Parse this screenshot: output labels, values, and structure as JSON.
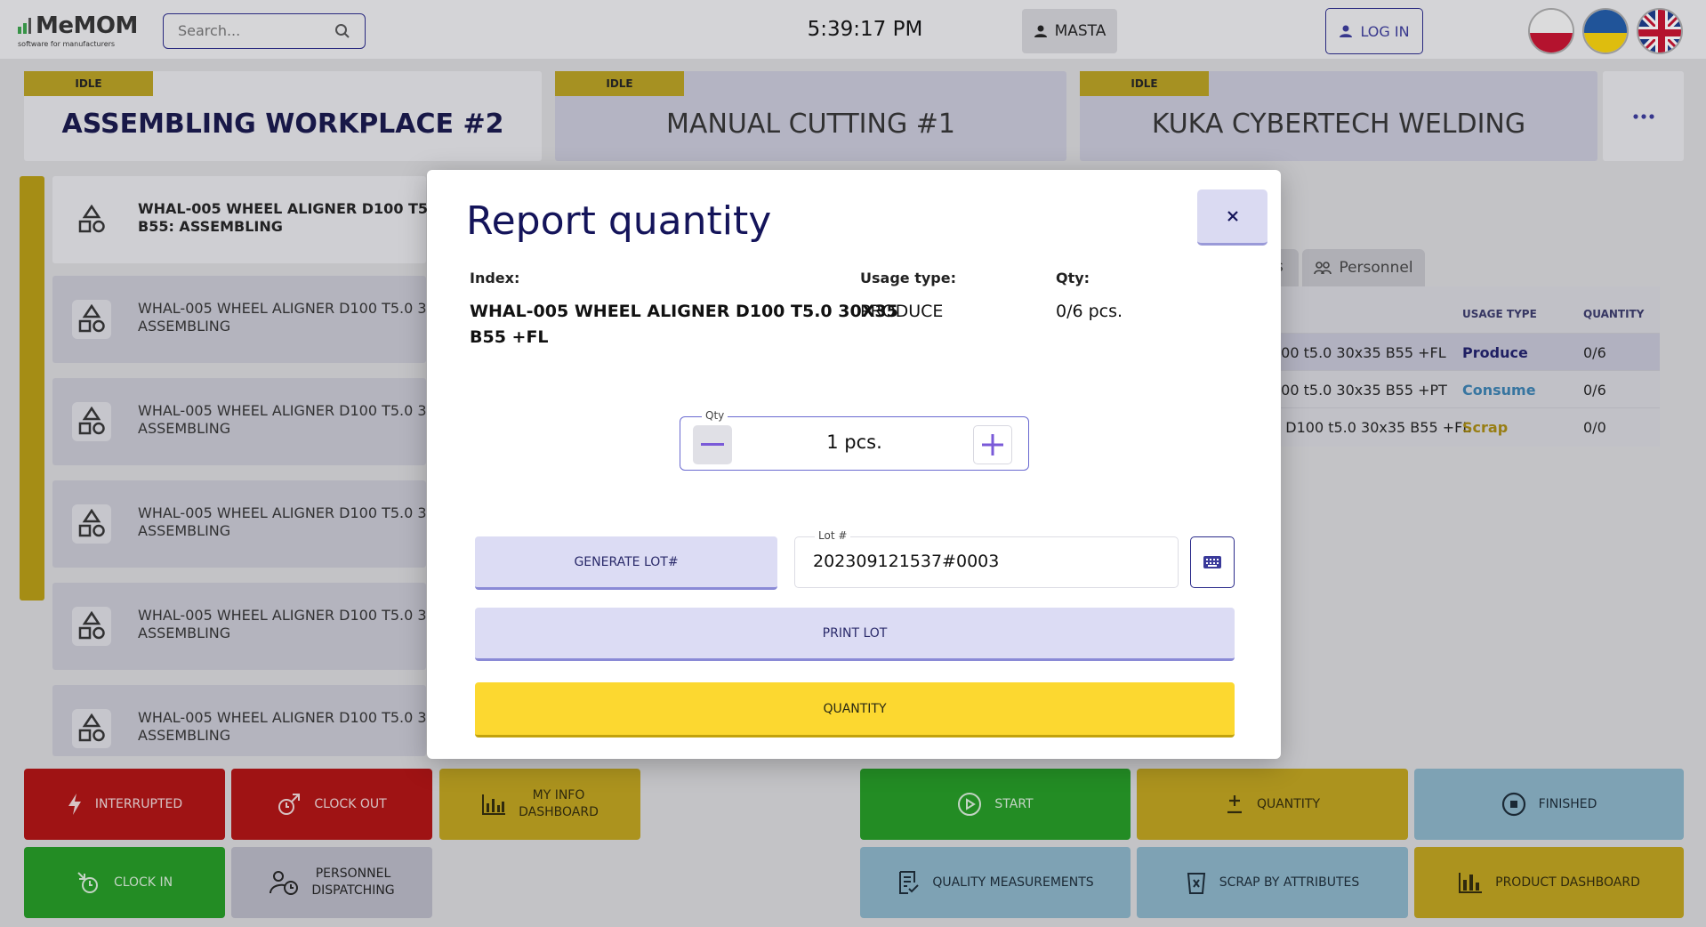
{
  "app": {
    "logo_name": "MeMOM",
    "logo_tagline": "software for manufacturers",
    "time": "5:39:17 PM",
    "user_label": "MASTA",
    "login_label": "LOG IN"
  },
  "search": {
    "placeholder": "Search..."
  },
  "languages": [
    "pl",
    "ua",
    "en"
  ],
  "workplaces": [
    {
      "status": "IDLE",
      "name": "ASSEMBLING WORKPLACE #2",
      "active": true
    },
    {
      "status": "IDLE",
      "name": "MANUAL CUTTING #1",
      "active": false
    },
    {
      "status": "IDLE",
      "name": "KUKA CYBERTECH WELDING",
      "active": false
    }
  ],
  "tasks": [
    {
      "line1": "WHAL-005 WHEEL ALIGNER D100 T5.0 30X35",
      "line2": "B55: ASSEMBLING"
    },
    {
      "line1": "WHAL-005 WHEEL ALIGNER D100 T5.0 30X35",
      "line2": "ASSEMBLING"
    },
    {
      "line1": "WHAL-005 WHEEL ALIGNER D100 T5.0 30X35",
      "line2": "ASSEMBLING"
    },
    {
      "line1": "WHAL-005 WHEEL ALIGNER D100 T5.0 30X35",
      "line2": "ASSEMBLING"
    },
    {
      "line1": "WHAL-005 WHEEL ALIGNER D100 T5.0 30X35",
      "line2": "ASSEMBLING"
    },
    {
      "line1": "WHAL-005 WHEEL ALIGNER D100 T5.0 30X35",
      "line2": "ASSEMBLING"
    }
  ],
  "detail_tabs": {
    "partial": "s",
    "personnel": "Personnel"
  },
  "materials_table": {
    "headers": {
      "usage_type": "USAGE TYPE",
      "quantity": "QUANTITY"
    },
    "rows": [
      {
        "name": "100 t5.0 30x35 B55 +FL",
        "usage": "Produce",
        "qty": "0/6",
        "color": "#1e1e6a"
      },
      {
        "name": "100 t5.0 30x35 B55 +PT",
        "usage": "Consume",
        "qty": "0/6",
        "color": "#3a80b0"
      },
      {
        "name": "2 D100 t5.0 30x35 B55 +FL",
        "usage": "Scrap",
        "qty": "0/0",
        "color": "#a88a10"
      }
    ]
  },
  "bottom_left": {
    "interrupted": "INTERRUPTED",
    "clock_out": "CLOCK OUT",
    "my_info_1": "MY INFO",
    "my_info_2": "DASHBOARD",
    "clock_in": "CLOCK IN",
    "personnel_1": "PERSONNEL",
    "personnel_2": "DISPATCHING"
  },
  "bottom_right": {
    "start": "START",
    "quantity": "QUANTITY",
    "finished": "FINISHED",
    "quality": "QUALITY MEASUREMENTS",
    "scrap": "SCRAP BY ATTRIBUTES",
    "product_dashboard": "PRODUCT DASHBOARD"
  },
  "modal": {
    "title": "Report quantity",
    "index_label": "Index:",
    "index_value_1": "WHAL-005 WHEEL ALIGNER D100 T5.0 30X35",
    "index_value_2": "B55 +FL",
    "usage_label": "Usage type:",
    "usage_value": "PRODUCE",
    "qty_label": "Qty:",
    "qty_value": "0/6 pcs.",
    "qty_input_legend": "Qty",
    "qty_input_value": "1 pcs.",
    "generate_lot": "GENERATE LOT#",
    "lot_legend": "Lot #",
    "lot_value": "202309121537#0003",
    "print_lot": "PRINT LOT",
    "submit": "QUANTITY"
  },
  "colors": {
    "accent": "#14145a",
    "idle_badge": "#b8a020",
    "submit": "#fcd830",
    "secondary_button": "#dcdcf4"
  }
}
